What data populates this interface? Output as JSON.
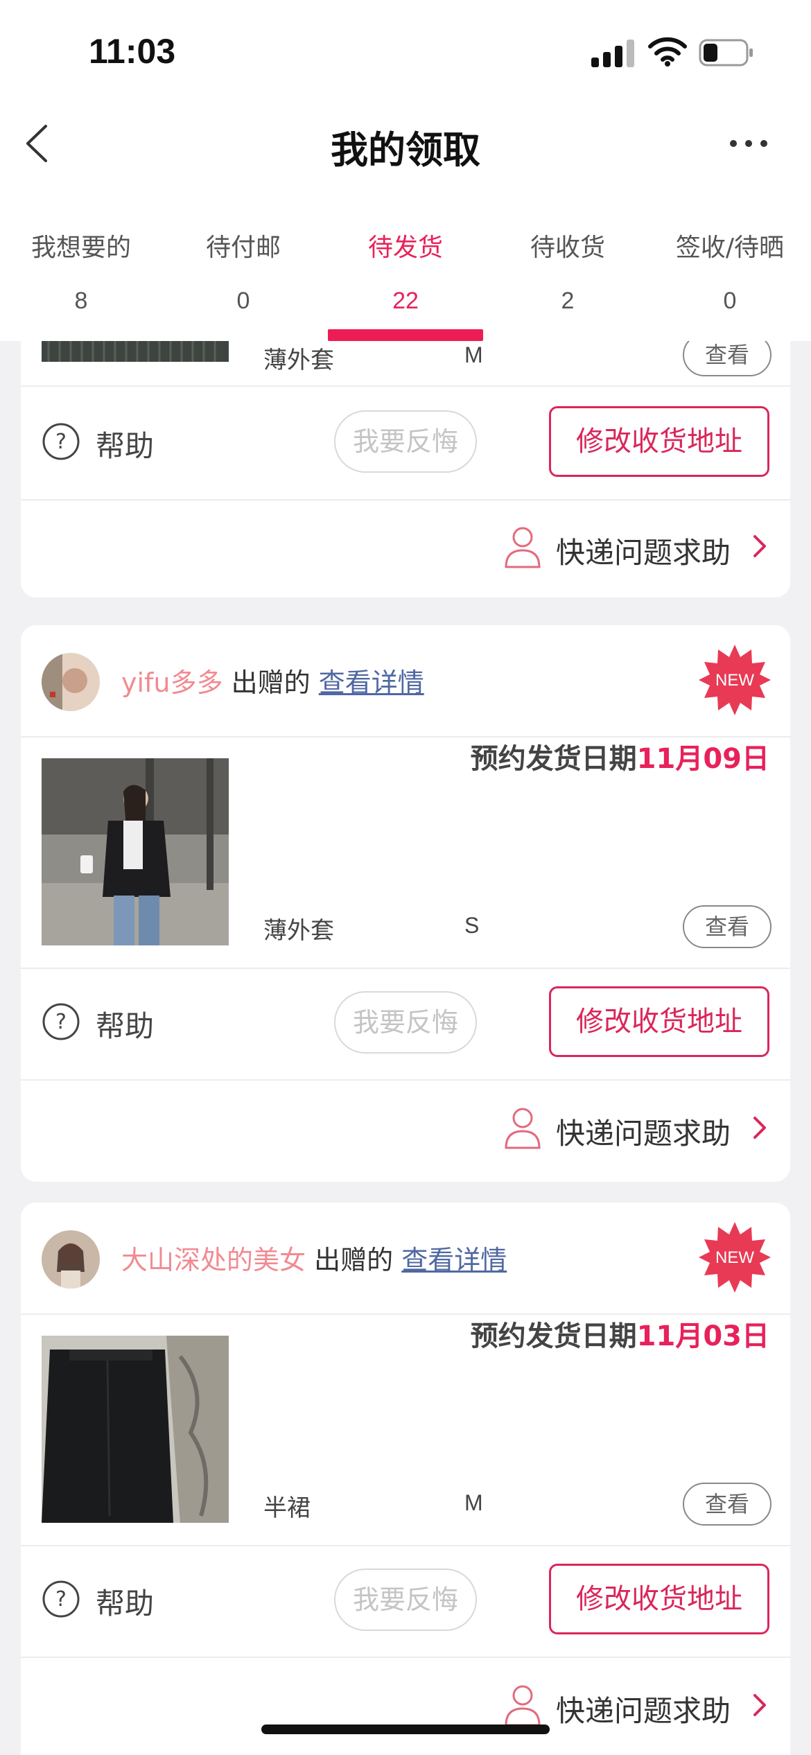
{
  "status": {
    "time": "11:03"
  },
  "nav": {
    "title": "我的领取"
  },
  "tabs": [
    {
      "label": "我想要的",
      "count": "8"
    },
    {
      "label": "待付邮",
      "count": "0"
    },
    {
      "label": "待发货",
      "count": "22",
      "active": true
    },
    {
      "label": "待收货",
      "count": "2"
    },
    {
      "label": "签收/待晒",
      "count": "0"
    }
  ],
  "common": {
    "help": "帮助",
    "regret": "我要反悔",
    "modify_address": "修改收货地址",
    "courier_help": "快递问题求助",
    "view": "查看",
    "given_by": "出赠的",
    "view_detail": "查看详情",
    "ship_date_prefix": "预约发货日期",
    "new_badge": "NEW"
  },
  "orders": [
    {
      "product": "薄外套",
      "size": "M"
    },
    {
      "owner": "yifu多多",
      "ship_date": "11月09日",
      "product": "薄外套",
      "size": "S"
    },
    {
      "owner": "大山深处的美女",
      "ship_date": "11月03日",
      "product": "半裙",
      "size": "M"
    }
  ],
  "colors": {
    "accent": "#e8215a",
    "owner_name": "#f18a92",
    "link": "#5068a2"
  }
}
